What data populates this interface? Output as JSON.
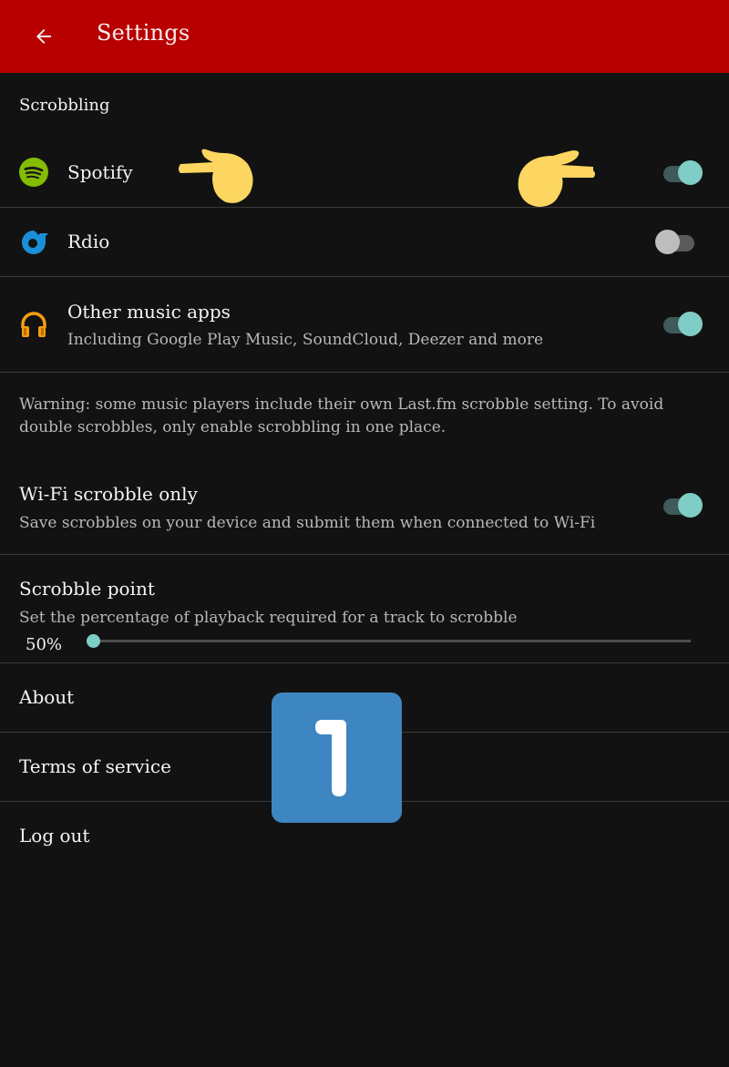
{
  "appbar": {
    "title": "Settings",
    "back_icon": "arrow-left-icon",
    "color": "#b80000"
  },
  "scrobbling": {
    "header": "Scrobbling",
    "apps": [
      {
        "label": "Spotify",
        "icon": "spotify-icon",
        "enabled": true
      },
      {
        "label": "Rdio",
        "icon": "rdio-icon",
        "enabled": false
      },
      {
        "label": "Other music apps",
        "summary": "Including Google Play Music, SoundCloud, Deezer and more",
        "icon": "headphones-icon",
        "enabled": true
      }
    ],
    "warning": "Warning: some music players include their own Last.fm scrobble setting. To avoid double scrobbles, only enable scrobbling in one place."
  },
  "wifi_only": {
    "label": "Wi-Fi scrobble only",
    "summary": "Save scrobbles on your device and submit them when connected to Wi-Fi",
    "enabled": true
  },
  "scrobble_point": {
    "label": "Scrobble point",
    "summary": "Set the percentage of playback required for a track to scrobble",
    "value_label": "50%",
    "slider_fraction": 0
  },
  "links": [
    {
      "label": "About"
    },
    {
      "label": "Terms of service"
    },
    {
      "label": "Log out"
    }
  ],
  "annotations": {
    "pointing_hands": [
      "backhand-index-pointing-right-emoji",
      "backhand-index-pointing-right-emoji"
    ],
    "number_badge": "1",
    "badge_color": "#3e86c2"
  },
  "colors": {
    "accent": "#7ecdc6",
    "background": "#121212",
    "spotify": "#84bd00",
    "rdio": "#1b8ed8",
    "play_music": "#f39c12"
  }
}
